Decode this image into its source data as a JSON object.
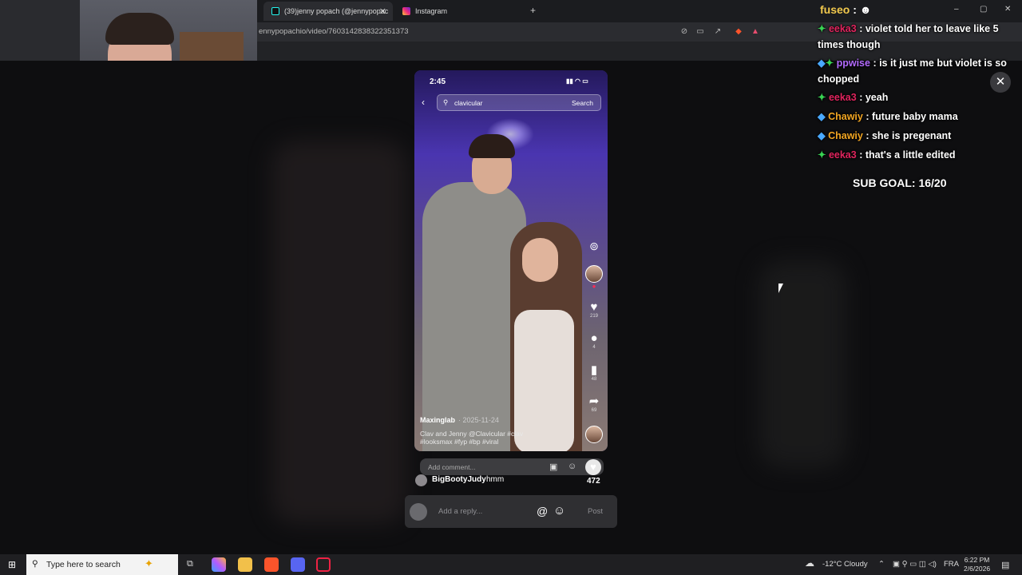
{
  "browser": {
    "tabs": [
      {
        "label": "(39)jenny popach (@jennypopac",
        "active": true
      },
      {
        "label": "Instagram",
        "active": false
      }
    ],
    "new_tab": "+",
    "url": "ennypopachio/video/7603142838322351373",
    "window_controls": {
      "minimize": "–",
      "maximize": "▢",
      "close": "✕"
    }
  },
  "chat": {
    "header_user": "fuseo",
    "messages": [
      {
        "user": "eeka3",
        "text": ": violet told her to leave like 5 times though",
        "user_color": "#e0245e"
      },
      {
        "user": "ppwise",
        "text": ": is it just me but violet is so chopped",
        "user_color": "#b36bff"
      },
      {
        "user": "eeka3",
        "text": ": yeah",
        "user_color": "#e0245e"
      },
      {
        "user": "Chawiy",
        "text": ": future baby mama",
        "user_color": "#f2a623"
      },
      {
        "user": "Chawiy",
        "text": ": she is pregenant",
        "user_color": "#f2a623"
      },
      {
        "user": "eeka3",
        "text": ": that's a little edited",
        "user_color": "#e0245e"
      }
    ],
    "sub_goal": "SUB GOAL: 16/20",
    "close": "✕"
  },
  "phone": {
    "time": "2:45",
    "search_query": "clavicular",
    "search_button": "Search",
    "side": {
      "likes": "219",
      "comments": "4",
      "saves": "48",
      "shares": "69"
    },
    "username": "Maxinglab",
    "date": "· 2025-11-24",
    "caption": "Clav and Jenny  @Clavicular #clav #looksmax #fyp #bp #viral"
  },
  "comment_bar": {
    "placeholder": "Add comment..."
  },
  "comment": {
    "user": "BigBootyJudy",
    "text": "hmm",
    "likes": "472"
  },
  "reply": {
    "placeholder": "Add a reply...",
    "mention": "@",
    "emoji": "☺",
    "post": "Post"
  },
  "taskbar": {
    "search_placeholder": "Type here to search",
    "weather": "-12°C  Cloudy",
    "lang": "FRA",
    "time": "6:22 PM",
    "date": "2/6/2026"
  }
}
